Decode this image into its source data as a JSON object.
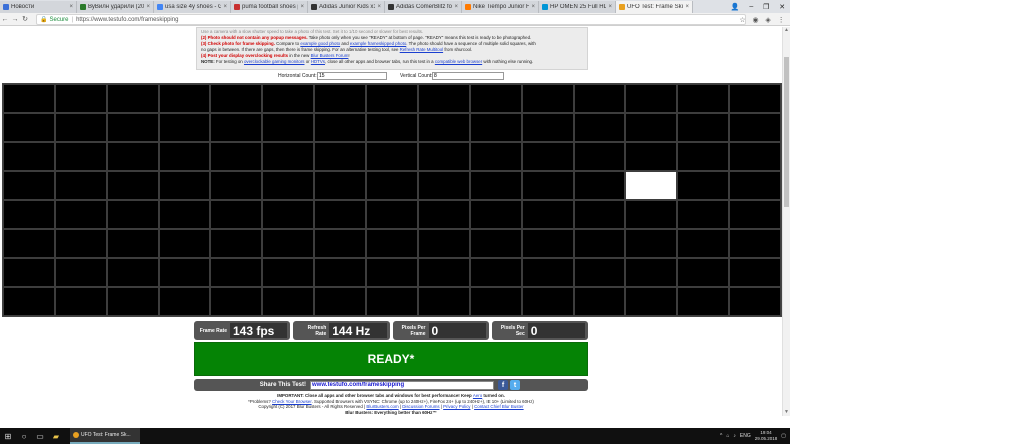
{
  "browser": {
    "tabs": [
      {
        "title": "Новости",
        "color": "#3a6fd8",
        "active": false
      },
      {
        "title": "ВуВилн ударили (20",
        "color": "#2a7a2a",
        "active": false
      },
      {
        "title": "usa size 4y shoes - Goo",
        "color": "#4285f4",
        "active": false
      },
      {
        "title": "puma football shoes pu",
        "color": "#c83030",
        "active": false
      },
      {
        "title": "Adidas Junior Kids x15",
        "color": "#333333",
        "active": false
      },
      {
        "title": "Adidas ComerBlitz foo",
        "color": "#333333",
        "active": false
      },
      {
        "title": "Nike Tiempo Junior Foo",
        "color": "#ff7a00",
        "active": false
      },
      {
        "title": "HP OMEN 25 Full HD",
        "color": "#0096d6",
        "active": false
      },
      {
        "title": "UFO Test: Frame Skippi",
        "color": "#e8a020",
        "active": true
      }
    ],
    "secure_label": "Secure",
    "url": "https://www.testufo.com/frameskipping"
  },
  "instructions": {
    "line0": "Use a camera with a slow shutter speed to take a photo of this test. Set it to 1/10 second or slower for best results.",
    "line1_label": "(2) Photo should not contain any popup messages.",
    "line1_text": " Take photo only when you see \"READY\" at bottom of page. \"READY\" means this test is ready to be photographed.",
    "line2_label": "(3) Check photo for frame skipping.",
    "line2_a": " Compare to ",
    "line2_link1": "example good photo",
    "line2_b": " and ",
    "line2_link2": "example frameskipped photo",
    "line2_c": ". The photo should have a sequence of multiple solid squares, with",
    "line3_a": "no gaps in between. If there are gaps, then there is frame skipping. For an alternative testing tool, see ",
    "line3_link": "Refresh Rate Multitool",
    "line3_b": " from shurcool.",
    "line4_label": "(4) Post your display overclocking results",
    "line4_a": " in the new ",
    "line4_link": "Blur Busters Forum",
    "line4_b": "!",
    "note_label": "NOTE:",
    "note_a": " For testing on ",
    "note_link1": "overclockable gaming monitors",
    "note_b": " or ",
    "note_link2": "HDTVs",
    "note_c": ", close all other apps and browser tabs, run this test in a ",
    "note_link3": "compatible web browser",
    "note_d": " with nothing else running."
  },
  "counts": {
    "horizontal_label": "Horizontal Count:",
    "horizontal_value": "15",
    "vertical_label": "Vertical Count:",
    "vertical_value": "8"
  },
  "grid": {
    "columns": 15,
    "rows": 8,
    "lit_row": 3,
    "lit_col": 12
  },
  "stats": [
    {
      "label": "Frame Rate",
      "value": "143 fps"
    },
    {
      "label": "Refresh Rate",
      "value": "144 Hz"
    },
    {
      "label": "Pixels Per Frame",
      "value": "0"
    },
    {
      "label": "Pixels Per Sec",
      "value": "0"
    }
  ],
  "ready_label": "READY*",
  "share": {
    "label": "Share This Test!",
    "url": "www.testufo.com/frameskipping",
    "fb": "f",
    "tw": "t"
  },
  "footer": {
    "important_label": "IMPORTANT: Close all apps and other browser tabs and windows for best performance! Keep ",
    "aero_link": "Aero",
    "important_end": " turned on.",
    "problems_a": "*Problems? ",
    "check_link": "Check Your Browser",
    "problems_b": ". Supported Browsers with VSYNC: Chrome (up to 240Hz+), FireFox 24+ (up to 240Hz+), IE 10+ (Limited to 60Hz)",
    "copyright": "Copyright (C) 2017 Blur Busters - All Rights Reserved | ",
    "link_bb": "BlurBusters.com",
    "link_forums": "Discussion Forums",
    "link_privacy": "Privacy Policy",
    "link_contact": "Contact Chief Blur Buster",
    "slogan": "Blur Busters: Everything better than 60Hz™"
  },
  "taskbar": {
    "task_title": "UFO Test: Frame Sk...",
    "lang": "ENG",
    "time": "19:04",
    "date": "29.05.2018"
  }
}
